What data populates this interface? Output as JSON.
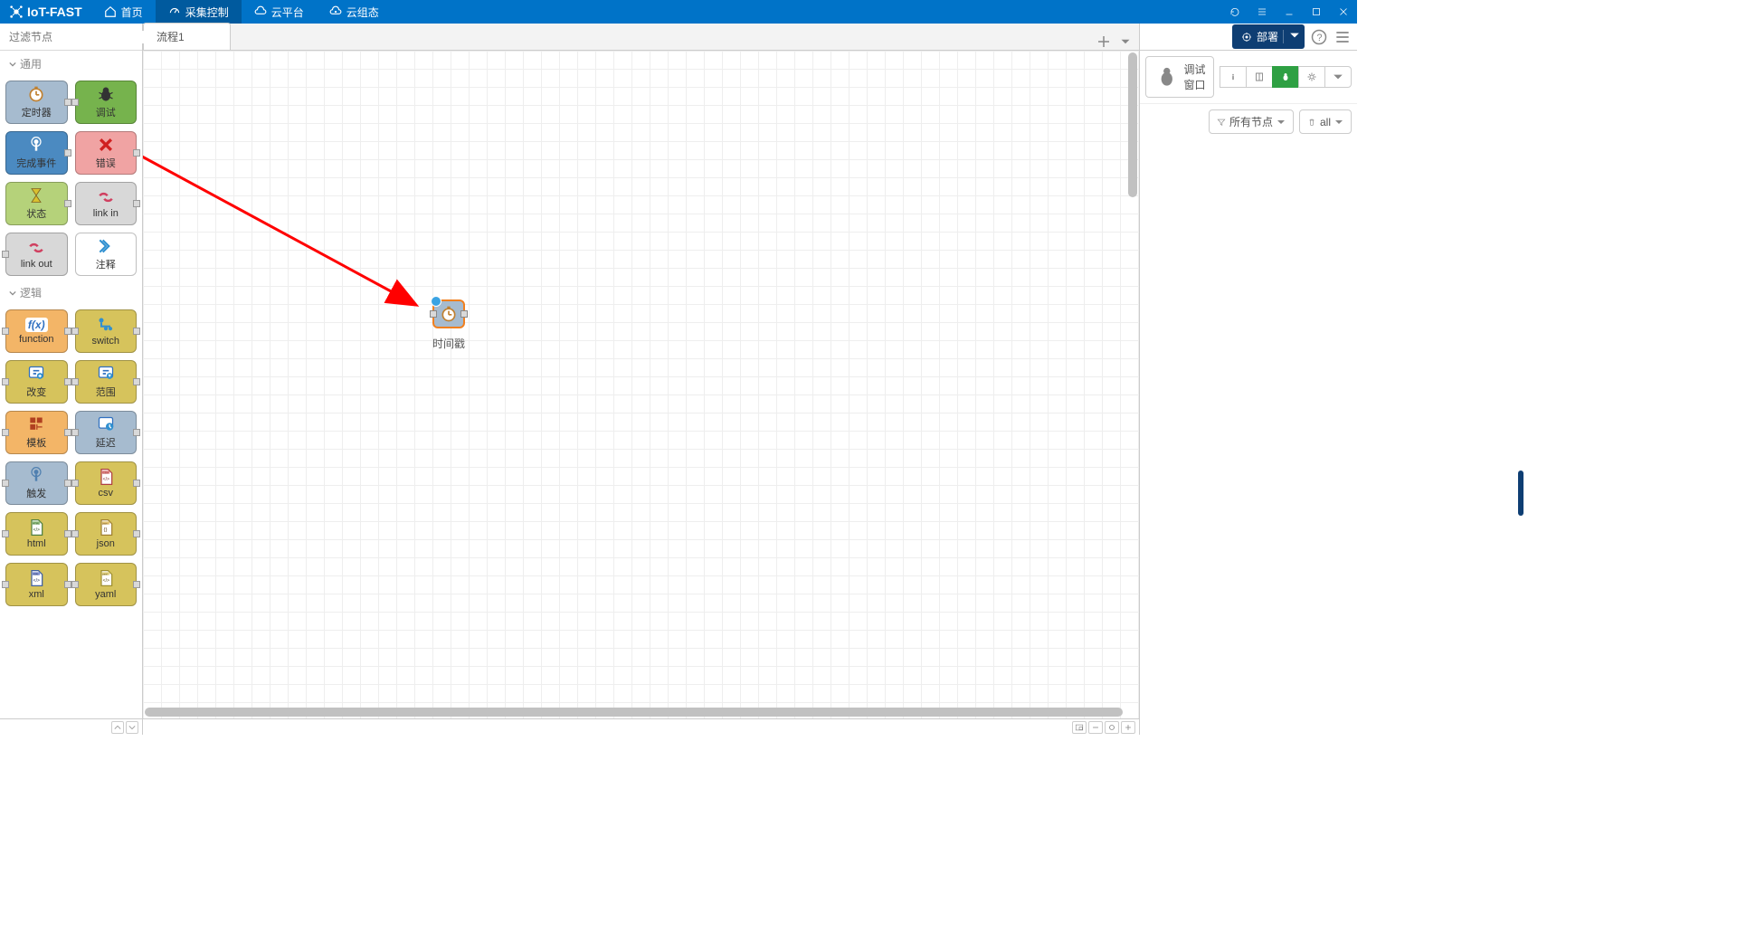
{
  "app": {
    "name": "IoT-FAST"
  },
  "menu": {
    "home": "首页",
    "collect": "采集控制",
    "cloud": "云平台",
    "cloudgroup": "云组态"
  },
  "palette": {
    "search_placeholder": "过滤节点",
    "categories": {
      "common": {
        "label": "通用"
      },
      "logic": {
        "label": "逻辑"
      }
    },
    "nodes": {
      "timer": "定时器",
      "debug": "调试",
      "complete": "完成事件",
      "error": "错误",
      "status": "状态",
      "link_in": "link in",
      "link_out": "link out",
      "comment": "注释",
      "function": "function",
      "switch": "switch",
      "change": "改变",
      "range": "范围",
      "template": "模板",
      "delay": "延迟",
      "trigger": "触发",
      "csv": "csv",
      "html": "html",
      "json": "json",
      "xml": "xml",
      "yaml": "yaml"
    }
  },
  "tabs": {
    "flow1": "流程1"
  },
  "canvas": {
    "node_label": "时间戳"
  },
  "rightbar": {
    "deploy": "部署",
    "debug_window": "调试窗口",
    "filter_all_nodes": "所有节点",
    "filter_all": "all"
  }
}
